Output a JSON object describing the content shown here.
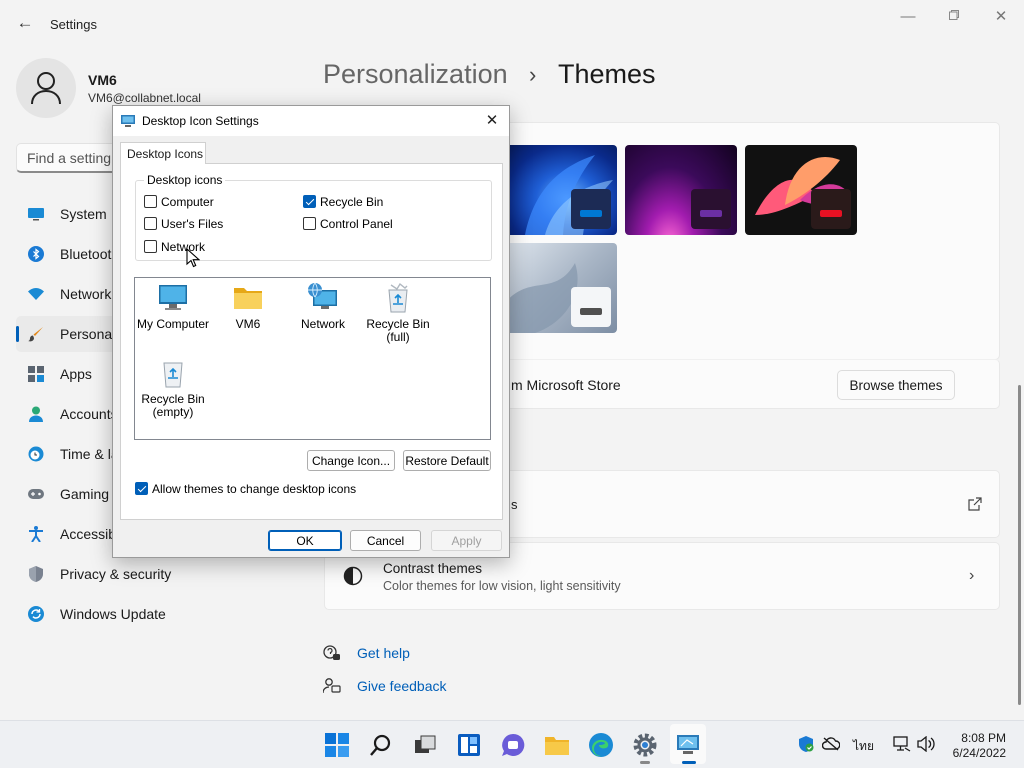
{
  "window": {
    "title": "Settings",
    "back_icon": "arrow-left-icon",
    "controls": [
      "minimize",
      "maximize",
      "close"
    ]
  },
  "user": {
    "name": "VM6",
    "email": "VM6@collabnet.local"
  },
  "search": {
    "placeholder": "Find a setting"
  },
  "sidebar": {
    "items": [
      {
        "label": "System",
        "icon": "monitor-icon"
      },
      {
        "label": "Bluetooth & devices",
        "icon": "bluetooth-icon"
      },
      {
        "label": "Network & internet",
        "icon": "wifi-icon"
      },
      {
        "label": "Personalization",
        "icon": "brush-icon",
        "active": true
      },
      {
        "label": "Apps",
        "icon": "apps-icon"
      },
      {
        "label": "Accounts",
        "icon": "person-icon"
      },
      {
        "label": "Time & language",
        "icon": "clock-globe-icon"
      },
      {
        "label": "Gaming",
        "icon": "gamepad-icon"
      },
      {
        "label": "Accessibility",
        "icon": "accessibility-icon"
      },
      {
        "label": "Privacy & security",
        "icon": "shield-icon"
      },
      {
        "label": "Windows Update",
        "icon": "update-icon"
      }
    ]
  },
  "breadcrumb": {
    "parent": "Personalization",
    "separator": "›",
    "current": "Themes"
  },
  "themes": {
    "thumbnails": [
      {
        "name": "windows-bloom-blue",
        "accent": "#0078d4"
      },
      {
        "name": "glow-purple",
        "accent": "#6b2fa3"
      },
      {
        "name": "captured-motion-red",
        "accent": "#e81123"
      },
      {
        "name": "sunrise-grey",
        "accent": "#505050"
      }
    ],
    "store_label": "m Microsoft Store",
    "browse_button": "Browse themes"
  },
  "settings_rows": {
    "desktop_icon_partial": "s",
    "contrast_title": "Contrast themes",
    "contrast_sub": "Color themes for low vision, light sensitivity"
  },
  "help": {
    "get_help": "Get help",
    "give_feedback": "Give feedback"
  },
  "dialog": {
    "title": "Desktop Icon Settings",
    "tab": "Desktop Icons",
    "group_title": "Desktop icons",
    "checkboxes": {
      "computer": {
        "label": "Computer",
        "checked": false
      },
      "users_files": {
        "label": "User's Files",
        "checked": false
      },
      "network": {
        "label": "Network",
        "checked": false
      },
      "recycle_bin": {
        "label": "Recycle Bin",
        "checked": true
      },
      "control_panel": {
        "label": "Control Panel",
        "checked": false
      }
    },
    "icons": [
      {
        "label": "My Computer",
        "icon": "monitor-icon"
      },
      {
        "label": "VM6",
        "icon": "folder-icon"
      },
      {
        "label": "Network",
        "icon": "network-globe-icon"
      },
      {
        "label": "Recycle Bin\n(full)",
        "icon": "recycle-bin-full-icon"
      },
      {
        "label": "Recycle Bin\n(empty)",
        "icon": "recycle-bin-empty-icon"
      }
    ],
    "change_icon": "Change Icon...",
    "restore_default": "Restore Default",
    "allow_themes": {
      "label": "Allow themes to change desktop icons",
      "checked": true
    },
    "ok": "OK",
    "cancel": "Cancel",
    "apply": "Apply"
  },
  "tray": {
    "language": "ไทย",
    "time": "8:08 PM",
    "date": "6/24/2022"
  },
  "colors": {
    "accent": "#005fb8",
    "background": "#f3f3f3",
    "taskbar": "#eef0f3"
  }
}
